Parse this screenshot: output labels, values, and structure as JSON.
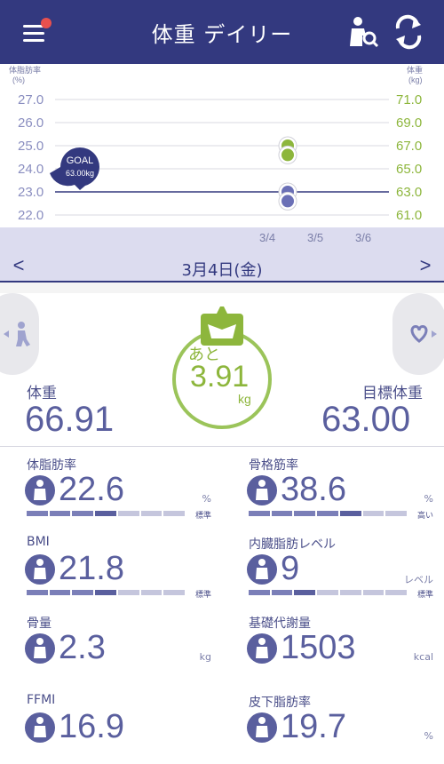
{
  "header": {
    "title": "体重 デイリー",
    "menu_icon": "menu-icon",
    "search_icon": "person-search-icon",
    "sync_icon": "sync-icon"
  },
  "chart_data": {
    "type": "scatter",
    "left_axis_label_line1": "体脂肪率",
    "left_axis_label_line2": "(%)",
    "right_axis_label_line1": "体重",
    "right_axis_label_line2": "(kg)",
    "left_ticks": [
      "27.0",
      "26.0",
      "25.0",
      "24.0",
      "23.0",
      "22.0"
    ],
    "right_ticks": [
      "71.0",
      "69.0",
      "67.0",
      "65.0",
      "63.0",
      "61.0"
    ],
    "x_ticks": [
      "3/4",
      "3/5",
      "3/6"
    ],
    "goal_label": "GOAL",
    "goal_value": "63.00kg",
    "goal_weight": 63.0,
    "weight_points": [
      {
        "x": "3/4",
        "y": 67.0
      },
      {
        "x": "3/4",
        "y": 66.2
      }
    ],
    "fat_points": [
      {
        "x": "3/4",
        "y": 23.0
      },
      {
        "x": "3/4",
        "y": 22.6
      }
    ],
    "left_range": [
      22.0,
      27.0
    ],
    "right_range": [
      61.0,
      71.0
    ],
    "colors": {
      "weight": "#8db63c",
      "fat": "#6b70b6",
      "goal": "#33397f"
    }
  },
  "date_nav": {
    "date": "3月4日(金)",
    "prev": "<",
    "next": ">"
  },
  "summary": {
    "remaining_label": "あと",
    "remaining_value": "3.91",
    "remaining_unit": "kg",
    "weight_label": "体重",
    "weight_value": "66.91",
    "target_label": "目標体重",
    "target_value": "63.00"
  },
  "metrics": [
    {
      "label": "体脂肪率",
      "value": "22.6",
      "unit": "%",
      "tag": "標準",
      "icon": "body-fat-icon",
      "level": 4
    },
    {
      "label": "骨格筋率",
      "value": "38.6",
      "unit": "%",
      "tag": "高い",
      "icon": "muscle-icon",
      "level": 5
    },
    {
      "label": "BMI",
      "value": "21.8",
      "unit": "",
      "tag": "標準",
      "icon": "bmi-person-icon",
      "level": 4
    },
    {
      "label": "内臓脂肪レベル",
      "value": "9",
      "unit": "レベル",
      "tag": "標準",
      "icon": "visceral-fat-icon",
      "level": 3
    },
    {
      "label": "骨量",
      "value": "2.3",
      "unit": "kg",
      "tag": "",
      "icon": "bone-icon",
      "level": 0
    },
    {
      "label": "基礎代謝量",
      "value": "1503",
      "unit": "kcal",
      "tag": "",
      "icon": "flame-icon",
      "level": 0
    },
    {
      "label": "FFMI",
      "value": "16.9",
      "unit": "",
      "tag": "",
      "icon": "ffmi-icon",
      "level": 0
    },
    {
      "label": "皮下脂肪率",
      "value": "19.7",
      "unit": "%",
      "tag": "",
      "icon": "subcutaneous-fat-icon",
      "level": 0
    }
  ]
}
